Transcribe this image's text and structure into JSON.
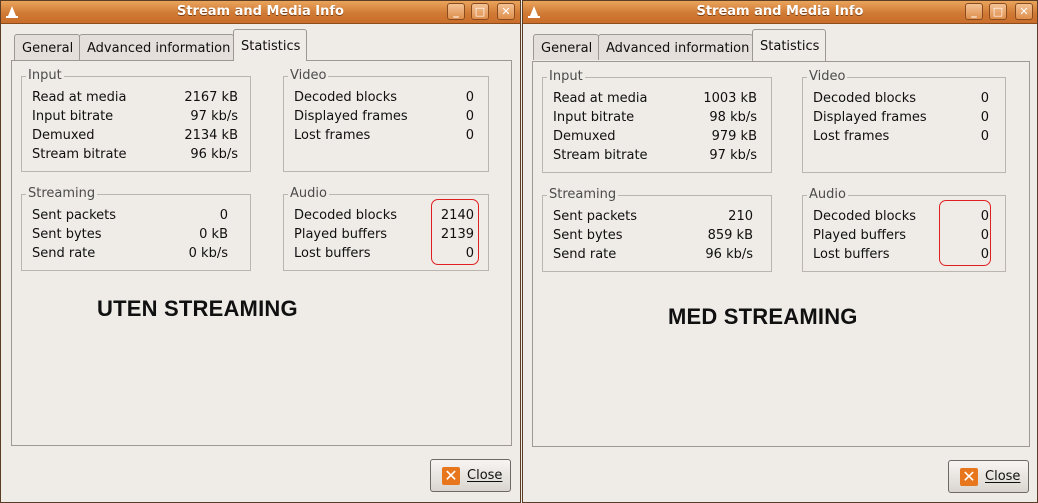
{
  "windows": [
    {
      "title": "Stream and Media Info",
      "tabs": [
        "General",
        "Advanced information",
        "Statistics"
      ],
      "active_tab": "Statistics",
      "input": {
        "title": "Input",
        "rows": [
          {
            "label": "Read at media",
            "value": "2167 kB"
          },
          {
            "label": "Input bitrate",
            "value": "97 kb/s"
          },
          {
            "label": "Demuxed",
            "value": "2134 kB"
          },
          {
            "label": "Stream bitrate",
            "value": "96 kb/s"
          }
        ]
      },
      "video": {
        "title": "Video",
        "rows": [
          {
            "label": "Decoded blocks",
            "value": "0"
          },
          {
            "label": "Displayed frames",
            "value": "0"
          },
          {
            "label": "Lost frames",
            "value": "0"
          }
        ]
      },
      "streaming": {
        "title": "Streaming",
        "rows": [
          {
            "label": "Sent packets",
            "value": "0"
          },
          {
            "label": "Sent bytes",
            "value": "0 kB"
          },
          {
            "label": "Send rate",
            "value": "0 kb/s"
          }
        ]
      },
      "audio": {
        "title": "Audio",
        "rows": [
          {
            "label": "Decoded blocks",
            "value": "2140"
          },
          {
            "label": "Played buffers",
            "value": "2139"
          },
          {
            "label": "Lost buffers",
            "value": "0"
          }
        ]
      },
      "annotation": "UTEN STREAMING",
      "close_label": "Close"
    },
    {
      "title": "Stream and Media Info",
      "tabs": [
        "General",
        "Advanced information",
        "Statistics"
      ],
      "active_tab": "Statistics",
      "input": {
        "title": "Input",
        "rows": [
          {
            "label": "Read at media",
            "value": "1003 kB"
          },
          {
            "label": "Input bitrate",
            "value": "98 kb/s"
          },
          {
            "label": "Demuxed",
            "value": "979 kB"
          },
          {
            "label": "Stream bitrate",
            "value": "97 kb/s"
          }
        ]
      },
      "video": {
        "title": "Video",
        "rows": [
          {
            "label": "Decoded blocks",
            "value": "0"
          },
          {
            "label": "Displayed frames",
            "value": "0"
          },
          {
            "label": "Lost frames",
            "value": "0"
          }
        ]
      },
      "streaming": {
        "title": "Streaming",
        "rows": [
          {
            "label": "Sent packets",
            "value": "210"
          },
          {
            "label": "Sent bytes",
            "value": "859 kB"
          },
          {
            "label": "Send rate",
            "value": "96 kb/s"
          }
        ]
      },
      "audio": {
        "title": "Audio",
        "rows": [
          {
            "label": "Decoded blocks",
            "value": "0"
          },
          {
            "label": "Played buffers",
            "value": "0"
          },
          {
            "label": "Lost buffers",
            "value": "0"
          }
        ]
      },
      "annotation": "MED STREAMING",
      "close_label": "Close"
    }
  ],
  "window_buttons": {
    "minimize": "_",
    "maximize": "□",
    "close": "✕"
  },
  "icons": {
    "title_menu": "vlc-cone-icon",
    "close_button": "close-x-icon"
  },
  "colors": {
    "titlebar": "#d07a35",
    "highlight": "#e02020",
    "close_icon": "#e8761c"
  }
}
